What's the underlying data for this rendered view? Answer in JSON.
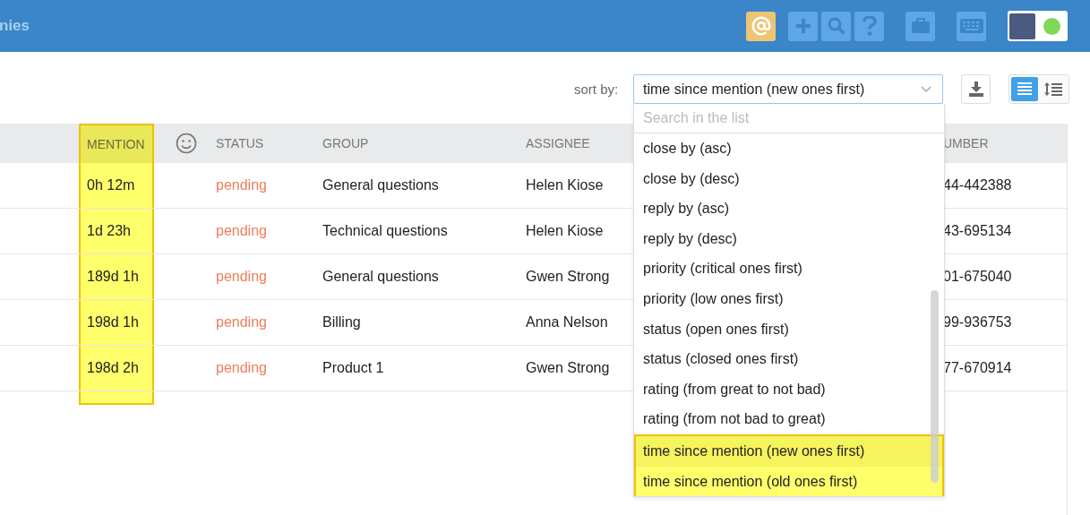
{
  "header": {
    "title": "nies",
    "icons": [
      {
        "kind": "mention",
        "active": true
      },
      {
        "kind": "add",
        "active": false
      },
      {
        "kind": "search",
        "active": false
      },
      {
        "kind": "help",
        "active": false
      },
      {
        "kind": "briefcase",
        "active": false
      },
      {
        "kind": "keyboard",
        "active": false
      }
    ]
  },
  "toolbar": {
    "sort_label": "sort by:",
    "sort_value": "time since mention (new ones first)",
    "view_modes": [
      {
        "kind": "list",
        "selected": true
      },
      {
        "kind": "lines",
        "selected": false
      }
    ]
  },
  "dropdown": {
    "placeholder": "Search in the list",
    "options": [
      {
        "label": "close by (asc)",
        "selected": false,
        "highlighted": false
      },
      {
        "label": "close by (desc)",
        "selected": false,
        "highlighted": false
      },
      {
        "label": "reply by (asc)",
        "selected": false,
        "highlighted": false
      },
      {
        "label": "reply by (desc)",
        "selected": false,
        "highlighted": false
      },
      {
        "label": "priority (critical ones first)",
        "selected": false,
        "highlighted": false
      },
      {
        "label": "priority (low ones first)",
        "selected": false,
        "highlighted": false
      },
      {
        "label": "status (open ones first)",
        "selected": false,
        "highlighted": false
      },
      {
        "label": "status (closed ones first)",
        "selected": false,
        "highlighted": false
      },
      {
        "label": "rating (from great to not bad)",
        "selected": false,
        "highlighted": false
      },
      {
        "label": "rating (from not bad to great)",
        "selected": false,
        "highlighted": false
      },
      {
        "label": "time since mention (new ones first)",
        "selected": true,
        "highlighted": true
      },
      {
        "label": "time since mention (old ones first)",
        "selected": false,
        "highlighted": true
      }
    ]
  },
  "table": {
    "columns": [
      {
        "kind": "text",
        "label": "MENTION",
        "highlighted": true
      },
      {
        "kind": "smiley",
        "highlighted": false
      },
      {
        "kind": "status",
        "label": "STATUS",
        "highlighted": false
      },
      {
        "kind": "text",
        "label": "GROUP",
        "highlighted": false
      },
      {
        "kind": "text",
        "label": "ASSIGNEE",
        "highlighted": false
      },
      {
        "kind": "text",
        "label": "UMBER",
        "highlighted": false
      }
    ],
    "rows": [
      {
        "cells": [
          "0h 12m",
          "",
          "pending",
          "General questions",
          "Helen Kiose",
          "44-442388"
        ]
      },
      {
        "cells": [
          "1d 23h",
          "",
          "pending",
          "Technical questions",
          "Helen Kiose",
          "43-695134"
        ]
      },
      {
        "cells": [
          "189d 1h",
          "",
          "pending",
          "General questions",
          "Gwen Strong",
          "01-675040"
        ]
      },
      {
        "cells": [
          "198d 1h",
          "",
          "pending",
          "Billing",
          "Anna Nelson",
          "99-936753"
        ]
      },
      {
        "cells": [
          "198d 2h",
          "",
          "pending",
          "Product 1",
          "Gwen Strong",
          "77-670914"
        ]
      }
    ]
  }
}
